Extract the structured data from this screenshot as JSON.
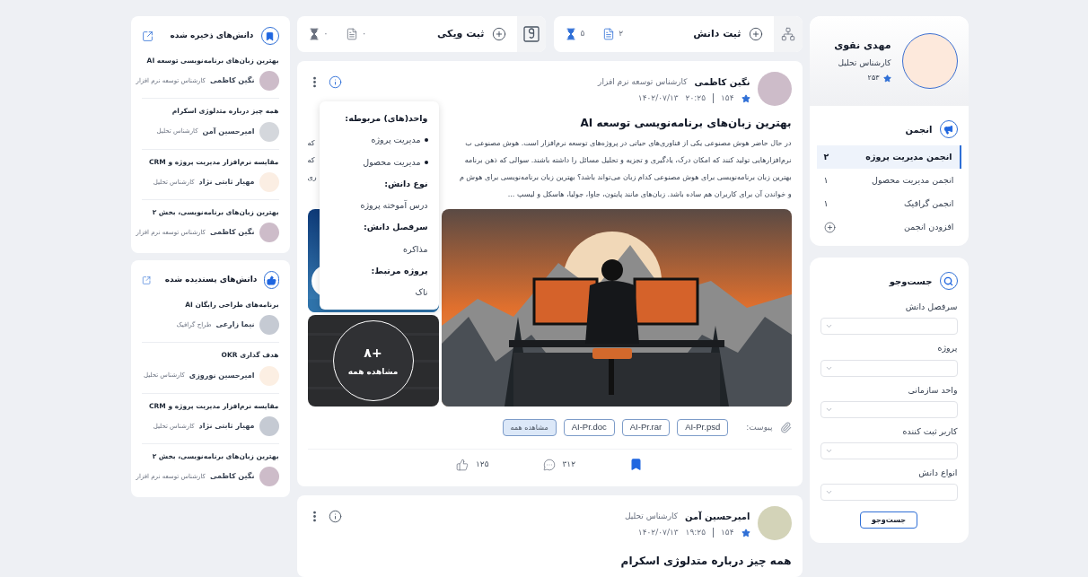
{
  "header_tabs": [
    {
      "kind": "knowledge",
      "label": "ثبت دانش",
      "docs": "۲",
      "pending": "۵",
      "active": true
    },
    {
      "kind": "wiki",
      "label": "ثبت ویکی",
      "docs": "۰",
      "pending": "۰",
      "active": false
    }
  ],
  "profile": {
    "name": "مهدی نقوی",
    "role": "کارشناس تحلیل",
    "score": "۲۵۳"
  },
  "forums": {
    "title": "انجمن",
    "items": [
      {
        "label": "انجمن مدیریت پروژه",
        "count": "۲",
        "selected": true
      },
      {
        "label": "انجمن مدیریت محصول",
        "count": "۱",
        "selected": false
      },
      {
        "label": "انجمن گرافیک",
        "count": "۱",
        "selected": false
      }
    ],
    "add_label": "افزودن انجمن"
  },
  "search": {
    "title": "جست‌وجو",
    "fields": [
      {
        "label": "سرفصل دانش"
      },
      {
        "label": "پروژه"
      },
      {
        "label": "واحد سازمانی"
      },
      {
        "label": "کاربر ثبت کننده"
      },
      {
        "label": "انواع دانش"
      }
    ],
    "button": "جست‌وجو"
  },
  "posts": [
    {
      "author": "نگین کاظمی",
      "role": "کارشناس توسعه نرم افزار",
      "color": "#cdbcc9",
      "score": "۱۵۴",
      "time": "۲۰:۲۵",
      "date": "۱۴۰۲/۰۷/۱۳",
      "info_open": true,
      "title": "بهترین زبان‌های برنامه‌نویسی توسعه AI",
      "lines": [
        {
          "text": "در حال حاضر هوش مصنوعی یکی از فناوری‌های حیاتی در پروژه‌های توسعه نرم‌افزار است. هوش مصنوعی ب",
          "tail": "که"
        },
        {
          "text": "نرم‌افزارهایی تولید کنند که امکان درک، یادگیری و تجزیه و تحلیل مسائل را داشته باشند. سوالی که ذهن برنامه",
          "tail": "که"
        },
        {
          "text": "بهترین زبان برنامه‌نویسی برای هوش مصنوعی کدام زبان می‌تواند باشد؟ بهترین زبان برنامه‌نویسی برای هوش م",
          "tail": "ری"
        },
        {
          "text": "و خواندن آن برای کاربران هم ساده باشد. زبان‌های مانند پایتون، جاوا، جولیا، هاسکل و لیسپ ..."
        }
      ],
      "popover": [
        {
          "heading": "واحد(های) مربوطه:",
          "kind": "list",
          "items": [
            "مدیریت پروژه",
            "مدیریت محصول"
          ]
        },
        {
          "heading": "نوع دانش:",
          "kind": "plain",
          "items": [
            "درس آموخته پروژه"
          ]
        },
        {
          "heading": "سرفصل دانش:",
          "kind": "plain",
          "items": [
            "مذاکره"
          ]
        },
        {
          "heading": "پروژه مرتبط:",
          "kind": "plain",
          "items": [
            "ناک"
          ]
        }
      ],
      "more_count": "+۸",
      "more_label": "مشاهده همه",
      "attach_label": "پیوست:",
      "files": [
        "AI-Pr.psd",
        "AI-Pr.rar",
        "AI-Pr.doc"
      ],
      "files_all": "مشاهده همه",
      "likes": "۱۲۵",
      "comments": "۳۱۲",
      "bookmarked": true
    },
    {
      "author": "امیرحسین آمن",
      "role": "کارشناس تحلیل",
      "color": "#d3d3b8",
      "score": "۱۵۴",
      "time": "۱۹:۲۵",
      "date": "۱۴۰۲/۰۷/۱۳",
      "info_open": false,
      "title": "همه چیز درباره متدلوژی اسکرام"
    }
  ],
  "panels": [
    {
      "kind": "saved",
      "title": "دانش‌های ذخیره شده",
      "items": [
        {
          "title": "بهترین زبان‌های برنامه‌نویسی توسعه AI",
          "name": "نگین کاظمی",
          "role": "کارشناس توسعه نرم افزار",
          "color": "#cdbcc9"
        },
        {
          "title": "همه چیز درباره متدلوژی اسکرام",
          "name": "امیرحسین آمن",
          "role": "کارشناس تحلیل",
          "color": "#d4d7dc"
        },
        {
          "title": "مقایسه نرم‌افزار مدیریت پروژه و CRM",
          "name": "مهیار ثابتی نژاد",
          "role": "کارشناس تحلیل",
          "color": "#fbeee3"
        },
        {
          "title": "بهترین زبان‌های برنامه‌نویسی، بخش ۲",
          "name": "نگین کاظمی",
          "role": "کارشناس توسعه نرم افزار",
          "color": "#cdbcc9"
        }
      ]
    },
    {
      "kind": "liked",
      "title": "دانش‌های پسندیده شده",
      "items": [
        {
          "title": "برنامه‌های طراحی رایگان AI",
          "name": "نیما زارعی",
          "role": "طراح گرافیک",
          "color": "#c5cad3"
        },
        {
          "title": "هدف گذاری OKR",
          "name": "امیرحسین نوروزی",
          "role": "کارشناس تحلیل",
          "color": "#fcefe3"
        },
        {
          "title": "مقایسه نرم‌افزار مدیریت پروژه و CRM",
          "name": "مهیار ثابتی نژاد",
          "role": "کارشناس تحلیل",
          "color": "#c5cad3"
        },
        {
          "title": "بهترین زبان‌های برنامه‌نویسی، بخش ۲",
          "name": "نگین کاظمی",
          "role": "کارشناس توسعه نرم افزار",
          "color": "#cdbcc9"
        }
      ]
    }
  ]
}
